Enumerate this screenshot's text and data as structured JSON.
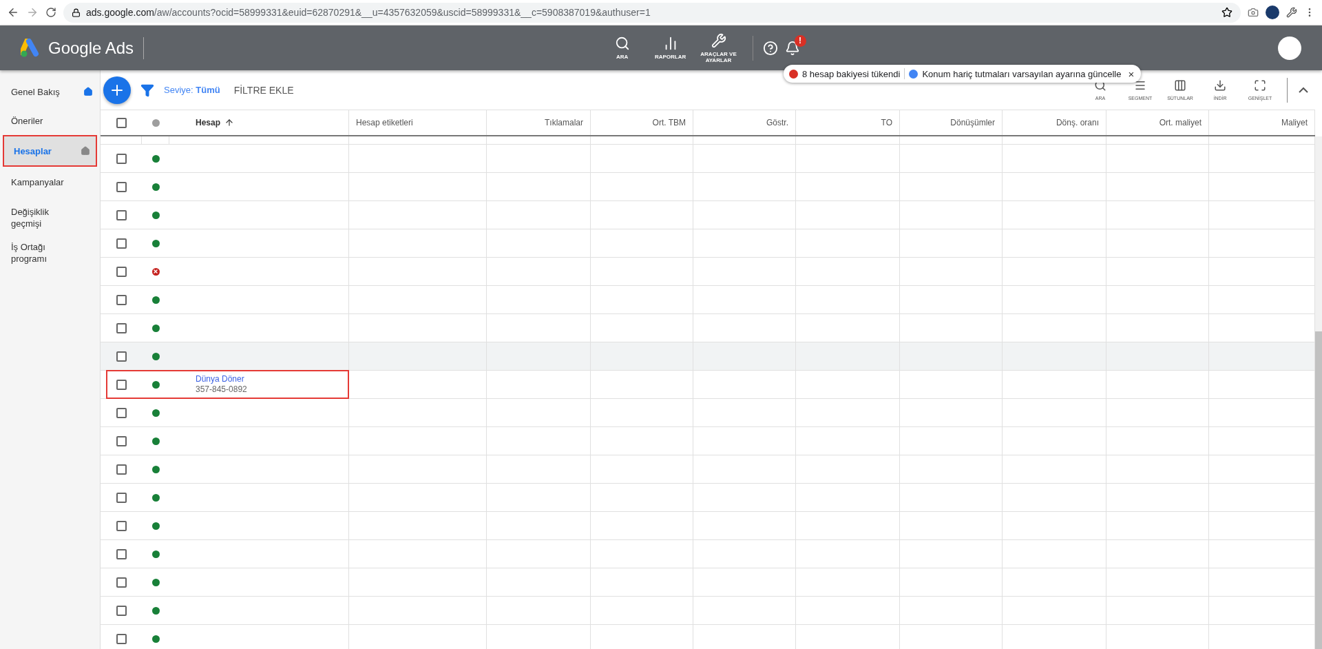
{
  "browser": {
    "url_host": "ads.google.com",
    "url_path": "/aw/accounts?ocid=58999331&euid=62870291&__u=4357632059&uscid=58999331&__c=5908387019&authuser=1"
  },
  "header": {
    "product": "Google Ads",
    "actions": [
      {
        "label": "ARA",
        "kind": "search"
      },
      {
        "label": "RAPORLAR",
        "kind": "reports"
      },
      {
        "label": "ARAÇLAR VE AYARLAR",
        "kind": "tools"
      }
    ],
    "bell_badge": "!"
  },
  "notice": {
    "alert": "8 hesap bakiyesi tükendi",
    "info": "Konum hariç tutmaları varsayılan ayarına güncelle",
    "close": "×"
  },
  "sidebar": {
    "items": [
      {
        "label": "Genel Bakış",
        "selected": false,
        "home": true,
        "annotated": false,
        "divider_after": false
      },
      {
        "label": "Öneriler",
        "selected": false,
        "home": false,
        "annotated": false,
        "divider_after": false
      },
      {
        "label": "Hesaplar",
        "selected": true,
        "home": true,
        "annotated": true,
        "divider_after": false
      },
      {
        "label": "Kampanyalar",
        "selected": false,
        "home": false,
        "annotated": false,
        "divider_after": true
      },
      {
        "label": "Değişiklik geçmişi",
        "selected": false,
        "home": false,
        "annotated": false,
        "divider_after": true
      },
      {
        "label": "İş Ortağı programı",
        "selected": false,
        "home": false,
        "annotated": false,
        "divider_after": false
      }
    ]
  },
  "toolbar": {
    "level_label": "Seviye:",
    "level_value": "Tümü",
    "add_filter": "FİLTRE EKLE",
    "tools": [
      {
        "label": "ARA",
        "kind": "search"
      },
      {
        "label": "SEGMENT",
        "kind": "segment"
      },
      {
        "label": "SÜTUNLAR",
        "kind": "columns"
      },
      {
        "label": "İNDİR",
        "kind": "download"
      },
      {
        "label": "GENİŞLET",
        "kind": "expand"
      }
    ]
  },
  "table": {
    "select_all_checked": false,
    "columns": [
      {
        "label": "Hesap",
        "sorted": true
      },
      {
        "label": "Hesap etiketleri",
        "sorted": false
      },
      {
        "label": "Tıklamalar",
        "sorted": false
      },
      {
        "label": "Ort. TBM",
        "sorted": false
      },
      {
        "label": "Göstr.",
        "sorted": false
      },
      {
        "label": "TO",
        "sorted": false
      },
      {
        "label": "Dönüşümler",
        "sorted": false
      },
      {
        "label": "Dönş. oranı",
        "sorted": false
      },
      {
        "label": "Ort. maliyet",
        "sorted": false
      },
      {
        "label": "Maliyet",
        "sorted": false
      }
    ],
    "rows": [
      {
        "kind": "active",
        "checked": false,
        "hovered": false,
        "annotated": false
      },
      {
        "kind": "active",
        "checked": false,
        "hovered": false,
        "annotated": false
      },
      {
        "kind": "active",
        "checked": false,
        "hovered": false,
        "annotated": false
      },
      {
        "kind": "active",
        "checked": false,
        "hovered": false,
        "annotated": false
      },
      {
        "kind": "removed",
        "checked": false,
        "hovered": false,
        "annotated": false
      },
      {
        "kind": "active",
        "checked": false,
        "hovered": false,
        "annotated": false
      },
      {
        "kind": "active",
        "checked": false,
        "hovered": false,
        "annotated": false
      },
      {
        "kind": "active",
        "checked": false,
        "hovered": true,
        "annotated": false
      },
      {
        "kind": "active",
        "checked": false,
        "hovered": false,
        "annotated": true,
        "name": "Dünya Döner",
        "account_id": "357-845-0892"
      },
      {
        "kind": "active",
        "checked": false,
        "hovered": false,
        "annotated": false
      },
      {
        "kind": "active",
        "checked": false,
        "hovered": false,
        "annotated": false
      },
      {
        "kind": "active",
        "checked": false,
        "hovered": false,
        "annotated": false
      },
      {
        "kind": "active",
        "checked": false,
        "hovered": false,
        "annotated": false
      },
      {
        "kind": "active",
        "checked": false,
        "hovered": false,
        "annotated": false
      },
      {
        "kind": "active",
        "checked": false,
        "hovered": false,
        "annotated": false
      },
      {
        "kind": "active",
        "checked": false,
        "hovered": false,
        "annotated": false
      },
      {
        "kind": "active",
        "checked": false,
        "hovered": false,
        "annotated": false
      },
      {
        "kind": "active",
        "checked": false,
        "hovered": false,
        "annotated": false
      }
    ]
  }
}
